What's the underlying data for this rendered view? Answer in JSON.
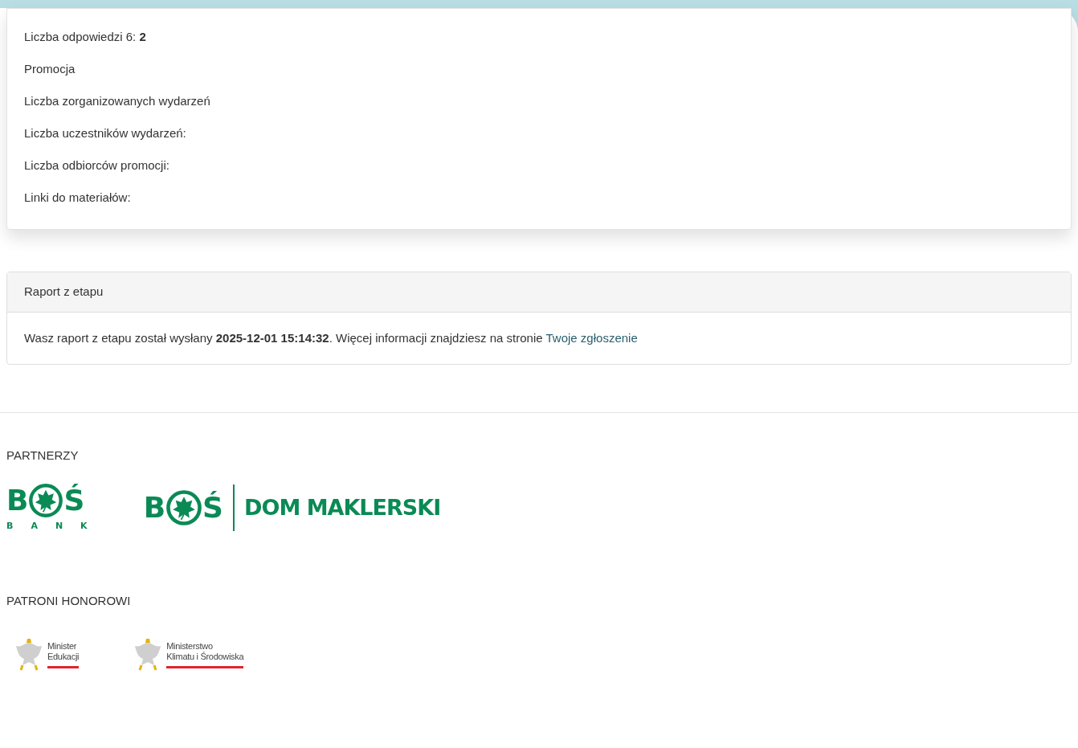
{
  "details": [
    {
      "label": "Liczba odpowiedzi 6:",
      "value": "2"
    },
    {
      "label": "Promocja"
    },
    {
      "label": "Liczba zorganizowanych wydarzeń"
    },
    {
      "label": "Liczba uczestników wydarzeń:"
    },
    {
      "label": "Liczba odbiorców promocji:"
    },
    {
      "label": "Linki do materiałów:"
    }
  ],
  "report": {
    "title": "Raport z etapu",
    "text": "Wasz raport z etapu został wysłany **2025-12-01 15:14:32**. Więcej informacji znajdziesz na stronie",
    "link": "Twoje zgłoszenie"
  },
  "partners": {
    "heading": "PARTNERZY",
    "logos": [
      {
        "kind": "bank",
        "left": "B",
        "right": "Ś",
        "sub": "BANK"
      },
      {
        "kind": "broker",
        "left": "B",
        "right": "Ś",
        "name": "DOM MAKLERSKI"
      }
    ]
  },
  "patrons": {
    "heading": "PATRONI HONOROWI",
    "logos": [
      {
        "lines": [
          "Minister",
          "Edukacji"
        ]
      },
      {
        "lines": [
          "Ministerstwo",
          "Klimatu i Środowiska"
        ]
      }
    ]
  }
}
